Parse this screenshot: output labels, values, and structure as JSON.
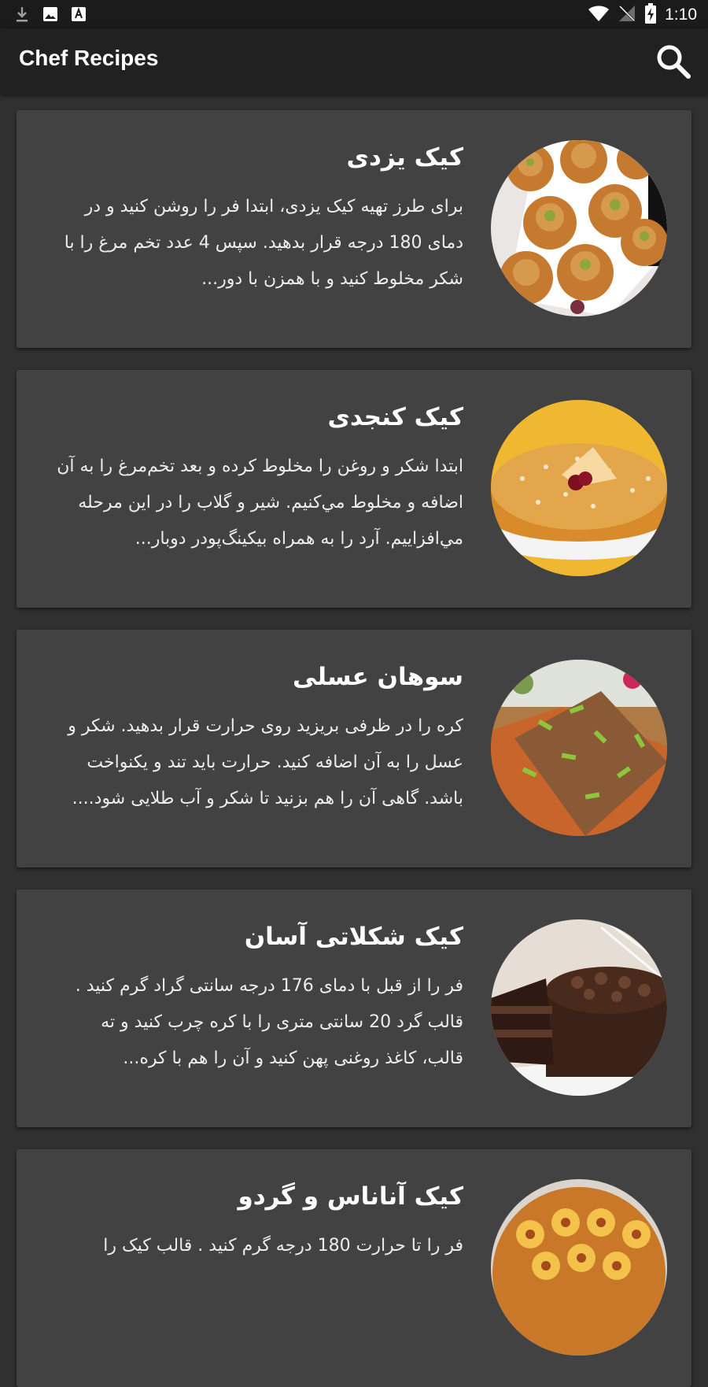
{
  "status_bar": {
    "time": "1:10",
    "left_icons": [
      "download-icon",
      "image-icon",
      "keyboard-icon"
    ],
    "right_icons": [
      "wifi-icon",
      "no-signal-icon",
      "battery-charging-icon"
    ]
  },
  "app_bar": {
    "title": "Chef Recipes",
    "search_icon": "search-icon"
  },
  "colors": {
    "background": "#303030",
    "card": "#424242",
    "app_bar": "#212121",
    "status_bar": "#1b1b1b",
    "text": "#ffffff"
  },
  "recipes": [
    {
      "title": "کیک یزدی",
      "description": "برای طرز تهیه کیک یزدی، ابتدا فر را روشن کنید و در دمای 180 درجه قرار بدهید. سپس 4 عدد تخم مرغ را با شکر مخلوط کنید و با همزن با دور...",
      "image": "yazdi-cupcakes"
    },
    {
      "title": "کیک کنجدی",
      "description": "ابتدا شکر و روغن را مخلوط کرده و بعد تخم‌مرغ را به آن اضافه و مخلوط مي‌كنيم. شير و گلاب را در اين مرحله مي‌افزاييم. آرد را به همراه بيكينگ‌پودر دوبار...",
      "image": "sesame-cake"
    },
    {
      "title": "سوهان عسلی",
      "description": "کره را در ظرفی بریزید روی حرارت قرار بدهید. شکر و عسل را به آن اضافه کنید. حرارت باید تند و یکنواخت باشد. گاهی آن را هم بزنید تا شکر و آب طلایی شود....",
      "image": "honey-sohan"
    },
    {
      "title": "کیک شکلاتی آسان",
      "description": "فر را از قبل با دمای 176 درجه سانتی گراد گرم کنید . قالب گرد 20 سانتی متری را با کره چرب کنید و ته قالب، کاغذ روغنی پهن کنید و آن را هم با کره...",
      "image": "chocolate-cake"
    },
    {
      "title": "کیک آناناس و گردو",
      "description": "فر را تا حرارت 180 درجه گرم کنید . قالب کیک را",
      "image": "pineapple-cake"
    }
  ]
}
